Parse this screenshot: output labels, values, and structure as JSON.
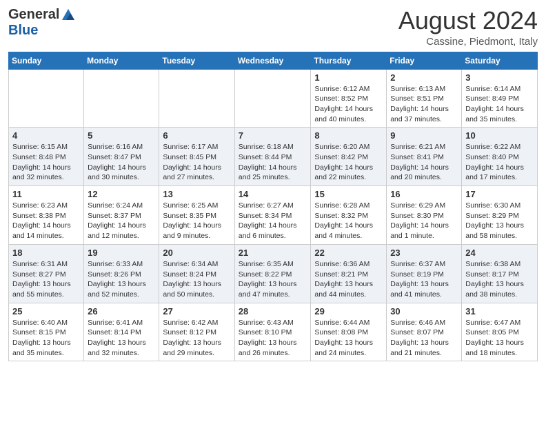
{
  "header": {
    "logo_general": "General",
    "logo_blue": "Blue",
    "month_title": "August 2024",
    "location": "Cassine, Piedmont, Italy"
  },
  "days_of_week": [
    "Sunday",
    "Monday",
    "Tuesday",
    "Wednesday",
    "Thursday",
    "Friday",
    "Saturday"
  ],
  "weeks": [
    [
      {
        "day": "",
        "info": ""
      },
      {
        "day": "",
        "info": ""
      },
      {
        "day": "",
        "info": ""
      },
      {
        "day": "",
        "info": ""
      },
      {
        "day": "1",
        "info": "Sunrise: 6:12 AM\nSunset: 8:52 PM\nDaylight: 14 hours\nand 40 minutes."
      },
      {
        "day": "2",
        "info": "Sunrise: 6:13 AM\nSunset: 8:51 PM\nDaylight: 14 hours\nand 37 minutes."
      },
      {
        "day": "3",
        "info": "Sunrise: 6:14 AM\nSunset: 8:49 PM\nDaylight: 14 hours\nand 35 minutes."
      }
    ],
    [
      {
        "day": "4",
        "info": "Sunrise: 6:15 AM\nSunset: 8:48 PM\nDaylight: 14 hours\nand 32 minutes."
      },
      {
        "day": "5",
        "info": "Sunrise: 6:16 AM\nSunset: 8:47 PM\nDaylight: 14 hours\nand 30 minutes."
      },
      {
        "day": "6",
        "info": "Sunrise: 6:17 AM\nSunset: 8:45 PM\nDaylight: 14 hours\nand 27 minutes."
      },
      {
        "day": "7",
        "info": "Sunrise: 6:18 AM\nSunset: 8:44 PM\nDaylight: 14 hours\nand 25 minutes."
      },
      {
        "day": "8",
        "info": "Sunrise: 6:20 AM\nSunset: 8:42 PM\nDaylight: 14 hours\nand 22 minutes."
      },
      {
        "day": "9",
        "info": "Sunrise: 6:21 AM\nSunset: 8:41 PM\nDaylight: 14 hours\nand 20 minutes."
      },
      {
        "day": "10",
        "info": "Sunrise: 6:22 AM\nSunset: 8:40 PM\nDaylight: 14 hours\nand 17 minutes."
      }
    ],
    [
      {
        "day": "11",
        "info": "Sunrise: 6:23 AM\nSunset: 8:38 PM\nDaylight: 14 hours\nand 14 minutes."
      },
      {
        "day": "12",
        "info": "Sunrise: 6:24 AM\nSunset: 8:37 PM\nDaylight: 14 hours\nand 12 minutes."
      },
      {
        "day": "13",
        "info": "Sunrise: 6:25 AM\nSunset: 8:35 PM\nDaylight: 14 hours\nand 9 minutes."
      },
      {
        "day": "14",
        "info": "Sunrise: 6:27 AM\nSunset: 8:34 PM\nDaylight: 14 hours\nand 6 minutes."
      },
      {
        "day": "15",
        "info": "Sunrise: 6:28 AM\nSunset: 8:32 PM\nDaylight: 14 hours\nand 4 minutes."
      },
      {
        "day": "16",
        "info": "Sunrise: 6:29 AM\nSunset: 8:30 PM\nDaylight: 14 hours\nand 1 minute."
      },
      {
        "day": "17",
        "info": "Sunrise: 6:30 AM\nSunset: 8:29 PM\nDaylight: 13 hours\nand 58 minutes."
      }
    ],
    [
      {
        "day": "18",
        "info": "Sunrise: 6:31 AM\nSunset: 8:27 PM\nDaylight: 13 hours\nand 55 minutes."
      },
      {
        "day": "19",
        "info": "Sunrise: 6:33 AM\nSunset: 8:26 PM\nDaylight: 13 hours\nand 52 minutes."
      },
      {
        "day": "20",
        "info": "Sunrise: 6:34 AM\nSunset: 8:24 PM\nDaylight: 13 hours\nand 50 minutes."
      },
      {
        "day": "21",
        "info": "Sunrise: 6:35 AM\nSunset: 8:22 PM\nDaylight: 13 hours\nand 47 minutes."
      },
      {
        "day": "22",
        "info": "Sunrise: 6:36 AM\nSunset: 8:21 PM\nDaylight: 13 hours\nand 44 minutes."
      },
      {
        "day": "23",
        "info": "Sunrise: 6:37 AM\nSunset: 8:19 PM\nDaylight: 13 hours\nand 41 minutes."
      },
      {
        "day": "24",
        "info": "Sunrise: 6:38 AM\nSunset: 8:17 PM\nDaylight: 13 hours\nand 38 minutes."
      }
    ],
    [
      {
        "day": "25",
        "info": "Sunrise: 6:40 AM\nSunset: 8:15 PM\nDaylight: 13 hours\nand 35 minutes."
      },
      {
        "day": "26",
        "info": "Sunrise: 6:41 AM\nSunset: 8:14 PM\nDaylight: 13 hours\nand 32 minutes."
      },
      {
        "day": "27",
        "info": "Sunrise: 6:42 AM\nSunset: 8:12 PM\nDaylight: 13 hours\nand 29 minutes."
      },
      {
        "day": "28",
        "info": "Sunrise: 6:43 AM\nSunset: 8:10 PM\nDaylight: 13 hours\nand 26 minutes."
      },
      {
        "day": "29",
        "info": "Sunrise: 6:44 AM\nSunset: 8:08 PM\nDaylight: 13 hours\nand 24 minutes."
      },
      {
        "day": "30",
        "info": "Sunrise: 6:46 AM\nSunset: 8:07 PM\nDaylight: 13 hours\nand 21 minutes."
      },
      {
        "day": "31",
        "info": "Sunrise: 6:47 AM\nSunset: 8:05 PM\nDaylight: 13 hours\nand 18 minutes."
      }
    ]
  ]
}
